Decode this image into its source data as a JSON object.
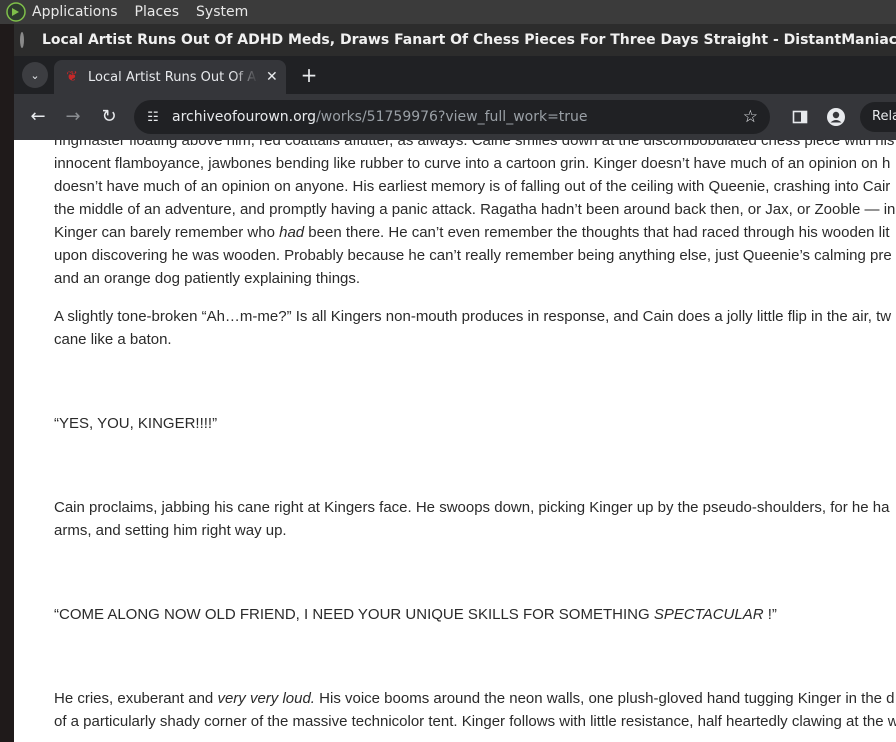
{
  "system_panel": {
    "menus": [
      "Applications",
      "Places",
      "System"
    ]
  },
  "window": {
    "title": "Local Artist Runs Out Of ADHD Meds, Draws Fanart Of Chess Pieces For Three Days Straight - DistantManiacalLaughter - The Amazing Dig"
  },
  "tab": {
    "title": "Local Artist Runs Out Of ADHD Meds, Draws Fanart Of Chess Pieces For Three Days Straight"
  },
  "address_bar": {
    "host": "archiveofourown.org",
    "path": "/works/51759976?view_full_work=true"
  },
  "toolbar": {
    "relaunch_label": "Rela"
  },
  "article": {
    "p1": [
      "ringmaster floating above him, red coattails aflutter, as always. Caine smiles down at the discombobulated chess piece with his",
      "innocent flamboyance, jawbones bending like rubber to curve into a cartoon grin. Kinger doesn’t have much of an opinion on h",
      "doesn’t have much of an opinion on anyone. His earliest memory is of falling out of the ceiling with Queenie, crashing into Cair",
      "the middle of an adventure, and promptly having a panic attack. Ragatha hadn’t been around back then, or Jax, or Zooble — in",
      "upon discovering he was wooden. Probably because he can’t really remember being anything else, just Queenie’s calming pre",
      "and an orange dog patiently explaining things."
    ],
    "p1_line5_before": "Kinger can barely remember who ",
    "p1_line5_em": "had",
    "p1_line5_after": " been there. He can’t even remember the thoughts that had raced through his wooden lit",
    "p2": [
      "A slightly tone-broken “Ah…m-me?” Is all Kingers non-mouth produces in response, and Cain does a jolly little flip in the air, tw",
      "cane like a baton."
    ],
    "p3": "“YES, YOU, KINGER!!!!”",
    "p4": [
      "Cain proclaims, jabbing his cane right at Kingers face. He swoops down, picking Kinger up by the pseudo-shoulders, for he ha",
      "arms, and setting him right way up."
    ],
    "p5_before": "“COME ALONG NOW OLD FRIEND, I NEED YOUR UNIQUE SKILLS FOR SOMETHING ",
    "p5_em": "SPECTACULAR",
    "p5_after": " !”",
    "p6_before": "He cries, exuberant and ",
    "p6_em": "very very loud.",
    "p6_after": " His voice booms around the neon walls, one plush-gloved hand tugging Kinger in the d",
    "p6_line2": "of a particularly shady corner of the massive technicolor tent. Kinger follows with little resistance, half heartedly clawing at the w"
  },
  "icons": {
    "app_logo": "gnome-foot-icon",
    "window": "window-icon",
    "tab_search": "chevron-down-icon",
    "favicon": "ao3-favicon-icon",
    "tab_close": "close-icon",
    "new_tab": "plus-icon",
    "back": "back-arrow-icon",
    "forward": "forward-arrow-icon",
    "reload": "reload-icon",
    "site_info": "tune-icon",
    "bookmark": "star-icon",
    "side_panel": "side-panel-icon",
    "profile": "profile-icon"
  }
}
